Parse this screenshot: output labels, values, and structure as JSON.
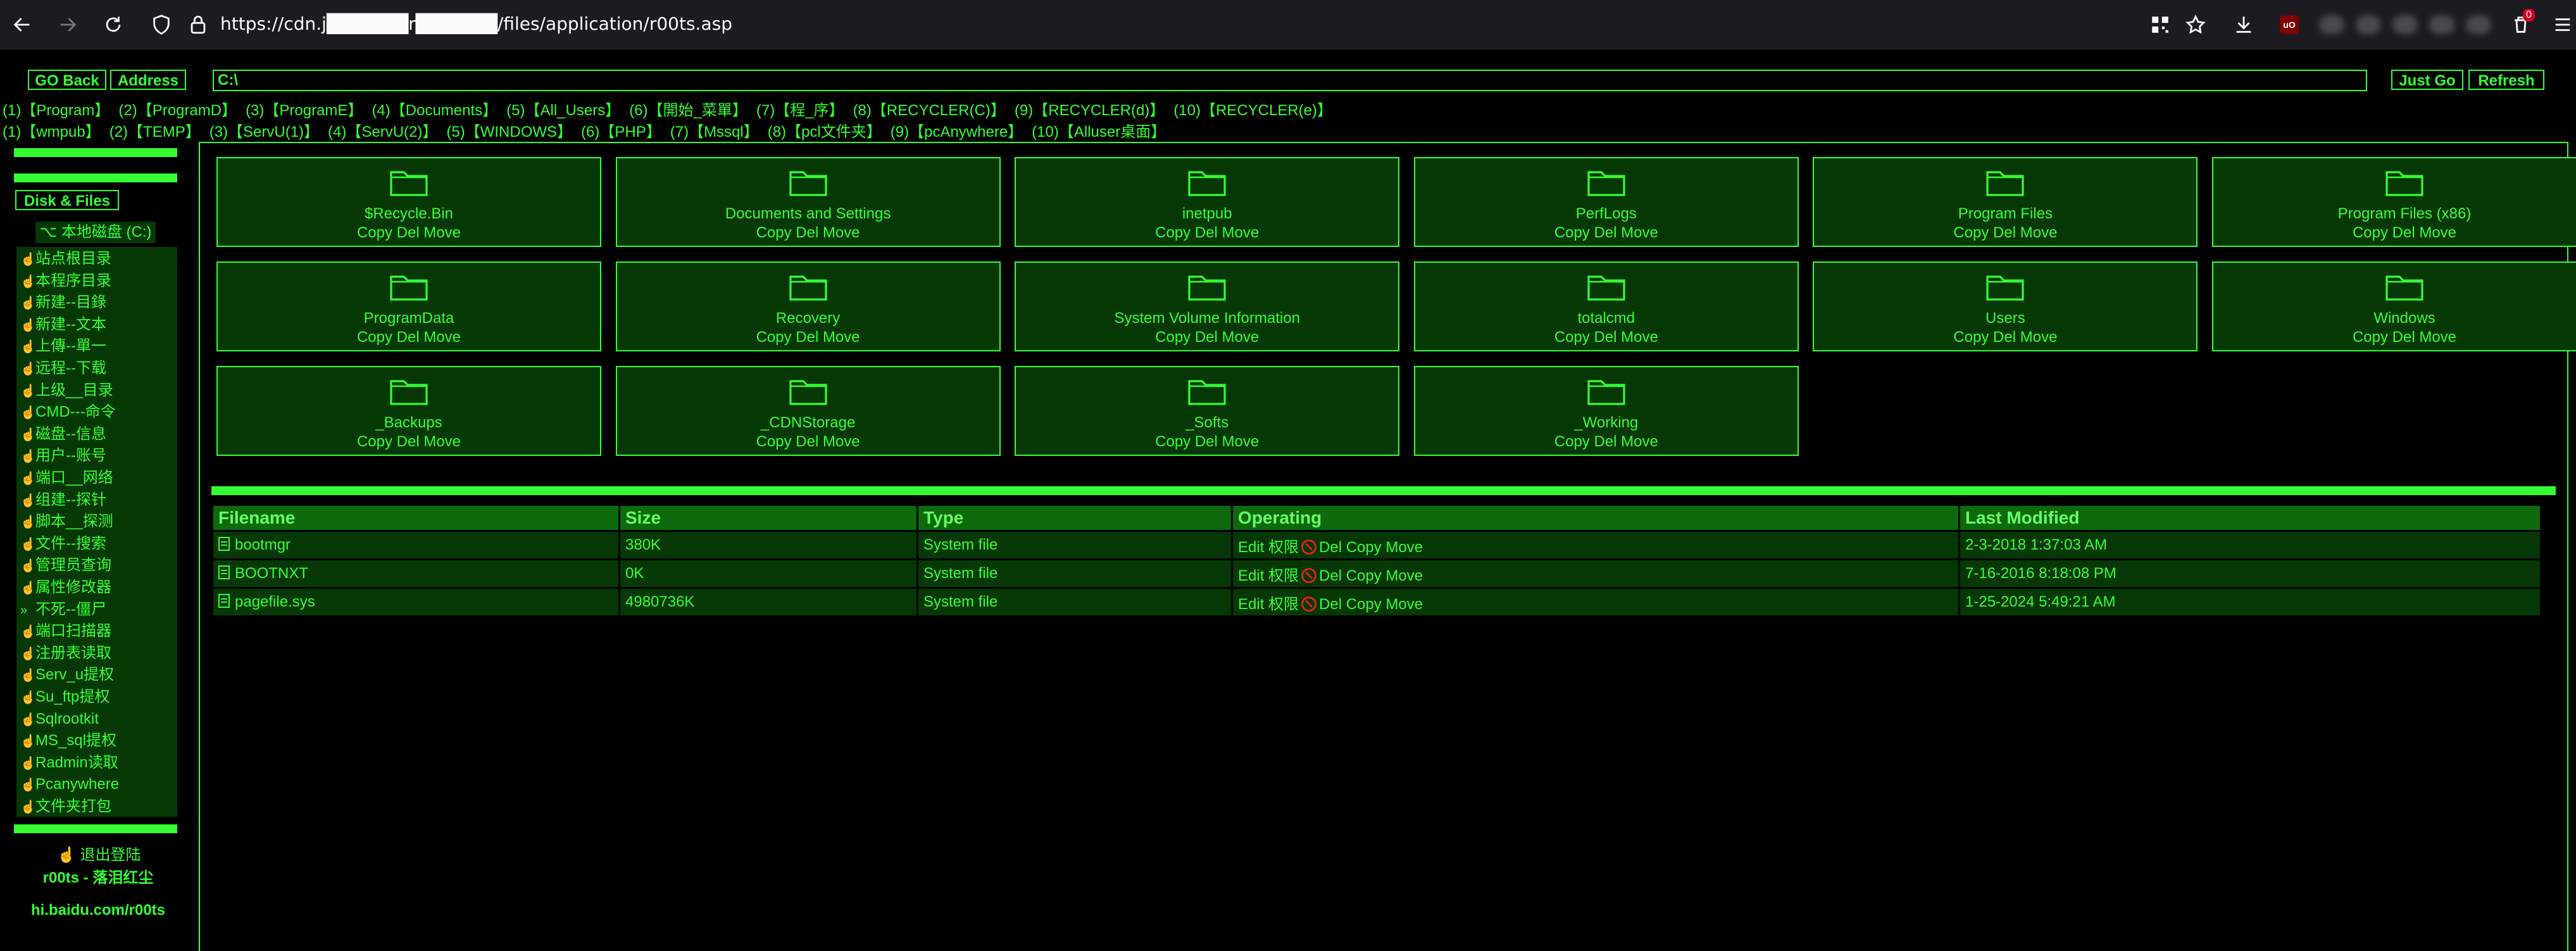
{
  "browser": {
    "url": "https://cdn.j██████r██████/files/application/r00ts.asp",
    "notification_count": "0",
    "ublock_label": "uO"
  },
  "toolbar": {
    "go_back": "GO Back",
    "address": "Address",
    "path_value": "C:\\",
    "just_go": "Just Go",
    "refresh": "Refresh"
  },
  "quick_links_row1": [
    "(1)【Program】",
    "(2)【ProgramD】",
    "(3)【ProgramE】",
    "(4)【Documents】",
    "(5)【All_Users】",
    "(6)【開始_菜單】",
    "(7)【程_序】",
    "(8)【RECYCLER(C)】",
    "(9)【RECYCLER(d)】",
    "(10)【RECYCLER(e)】"
  ],
  "quick_links_row2": [
    "(1)【wmpub】",
    "(2)【TEMP】",
    "(3)【ServU(1)】",
    "(4)【ServU(2)】",
    "(5)【WINDOWS】",
    "(6)【PHP】",
    "(7)【Mssql】",
    "(8)【pcl文件夹】",
    "(9)【pcAnywhere】",
    "(10)【Alluser桌面】"
  ],
  "sidebar": {
    "disk_files_label": "Disk & Files",
    "local_disk": "本地磁盘 (C:)",
    "items": [
      "站点根目录",
      "本程序目录",
      "新建--目錄",
      "新建--文本",
      "上傳--單一",
      "远程--下载",
      "上级__目录",
      "CMD---命令",
      "磁盘--信息",
      "用户--账号",
      "端口__网络",
      "组建--探针",
      "脚本__探测",
      "文件--搜索",
      "管理员查询",
      "属性修改器",
      "不死--僵尸",
      "端口扫描器",
      "注册表读取",
      "Serv_u提权",
      "Su_ftp提权",
      "Sqlrootkit",
      "MS_sql提权",
      "Radmin读取",
      "Pcanywhere",
      "文件夹打包"
    ],
    "logout": "退出登陆",
    "author": "r00ts - 落泪红尘",
    "site": "hi.baidu.com/r00ts"
  },
  "folders": [
    {
      "name": "$Recycle.Bin",
      "ops": "Copy Del Move"
    },
    {
      "name": "Documents and Settings",
      "ops": "Copy Del Move"
    },
    {
      "name": "inetpub",
      "ops": "Copy Del Move"
    },
    {
      "name": "PerfLogs",
      "ops": "Copy Del Move"
    },
    {
      "name": "Program Files",
      "ops": "Copy Del Move"
    },
    {
      "name": "Program Files (x86)",
      "ops": "Copy Del Move"
    },
    {
      "name": "ProgramData",
      "ops": "Copy Del Move"
    },
    {
      "name": "Recovery",
      "ops": "Copy Del Move"
    },
    {
      "name": "System Volume Information",
      "ops": "Copy Del Move"
    },
    {
      "name": "totalcmd",
      "ops": "Copy Del Move"
    },
    {
      "name": "Users",
      "ops": "Copy Del Move"
    },
    {
      "name": "Windows",
      "ops": "Copy Del Move"
    },
    {
      "name": "_Backups",
      "ops": "Copy Del Move"
    },
    {
      "name": "_CDNStorage",
      "ops": "Copy Del Move"
    },
    {
      "name": "_Softs",
      "ops": "Copy Del Move"
    },
    {
      "name": "_Working",
      "ops": "Copy Del Move"
    }
  ],
  "table": {
    "headers": {
      "filename": "Filename",
      "size": "Size",
      "type": "Type",
      "operating": "Operating",
      "modified": "Last Modified"
    },
    "op_edit": "Edit",
    "op_perm": "权限",
    "op_rest": "Del Copy Move",
    "rows": [
      {
        "filename": "bootmgr",
        "size": "380K",
        "type": "System file",
        "modified": "2-3-2018 1:37:03 AM"
      },
      {
        "filename": "BOOTNXT",
        "size": "0K",
        "type": "System file",
        "modified": "7-16-2016 8:18:08 PM"
      },
      {
        "filename": "pagefile.sys",
        "size": "4980736K",
        "type": "System file",
        "modified": "1-25-2024 5:49:21 AM"
      }
    ]
  }
}
